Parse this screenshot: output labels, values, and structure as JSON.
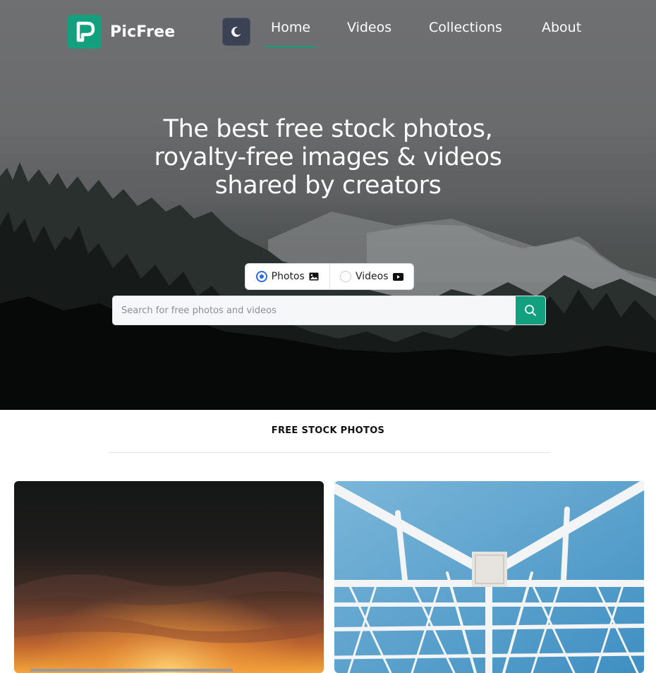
{
  "brand": {
    "name": "PicFree",
    "accent": "#12a07e"
  },
  "nav": {
    "theme_toggle_icon": "moon-icon",
    "items": [
      {
        "label": "Home",
        "active": true
      },
      {
        "label": "Videos",
        "active": false
      },
      {
        "label": "Collections",
        "active": false
      },
      {
        "label": "About",
        "active": false
      }
    ]
  },
  "hero": {
    "headline": "The best free stock photos, royalty-free images & videos shared by creators"
  },
  "search": {
    "types": [
      {
        "label": "Photos",
        "icon": "image-icon",
        "selected": true
      },
      {
        "label": "Videos",
        "icon": "video-icon",
        "selected": false
      }
    ],
    "placeholder": "Search for free photos and videos",
    "button_icon": "search-icon"
  },
  "section": {
    "title": "FREE STOCK PHOTOS"
  },
  "photos": [
    {
      "subject": "sunset-sky"
    },
    {
      "subject": "white-ferris-wheel-structure"
    }
  ]
}
